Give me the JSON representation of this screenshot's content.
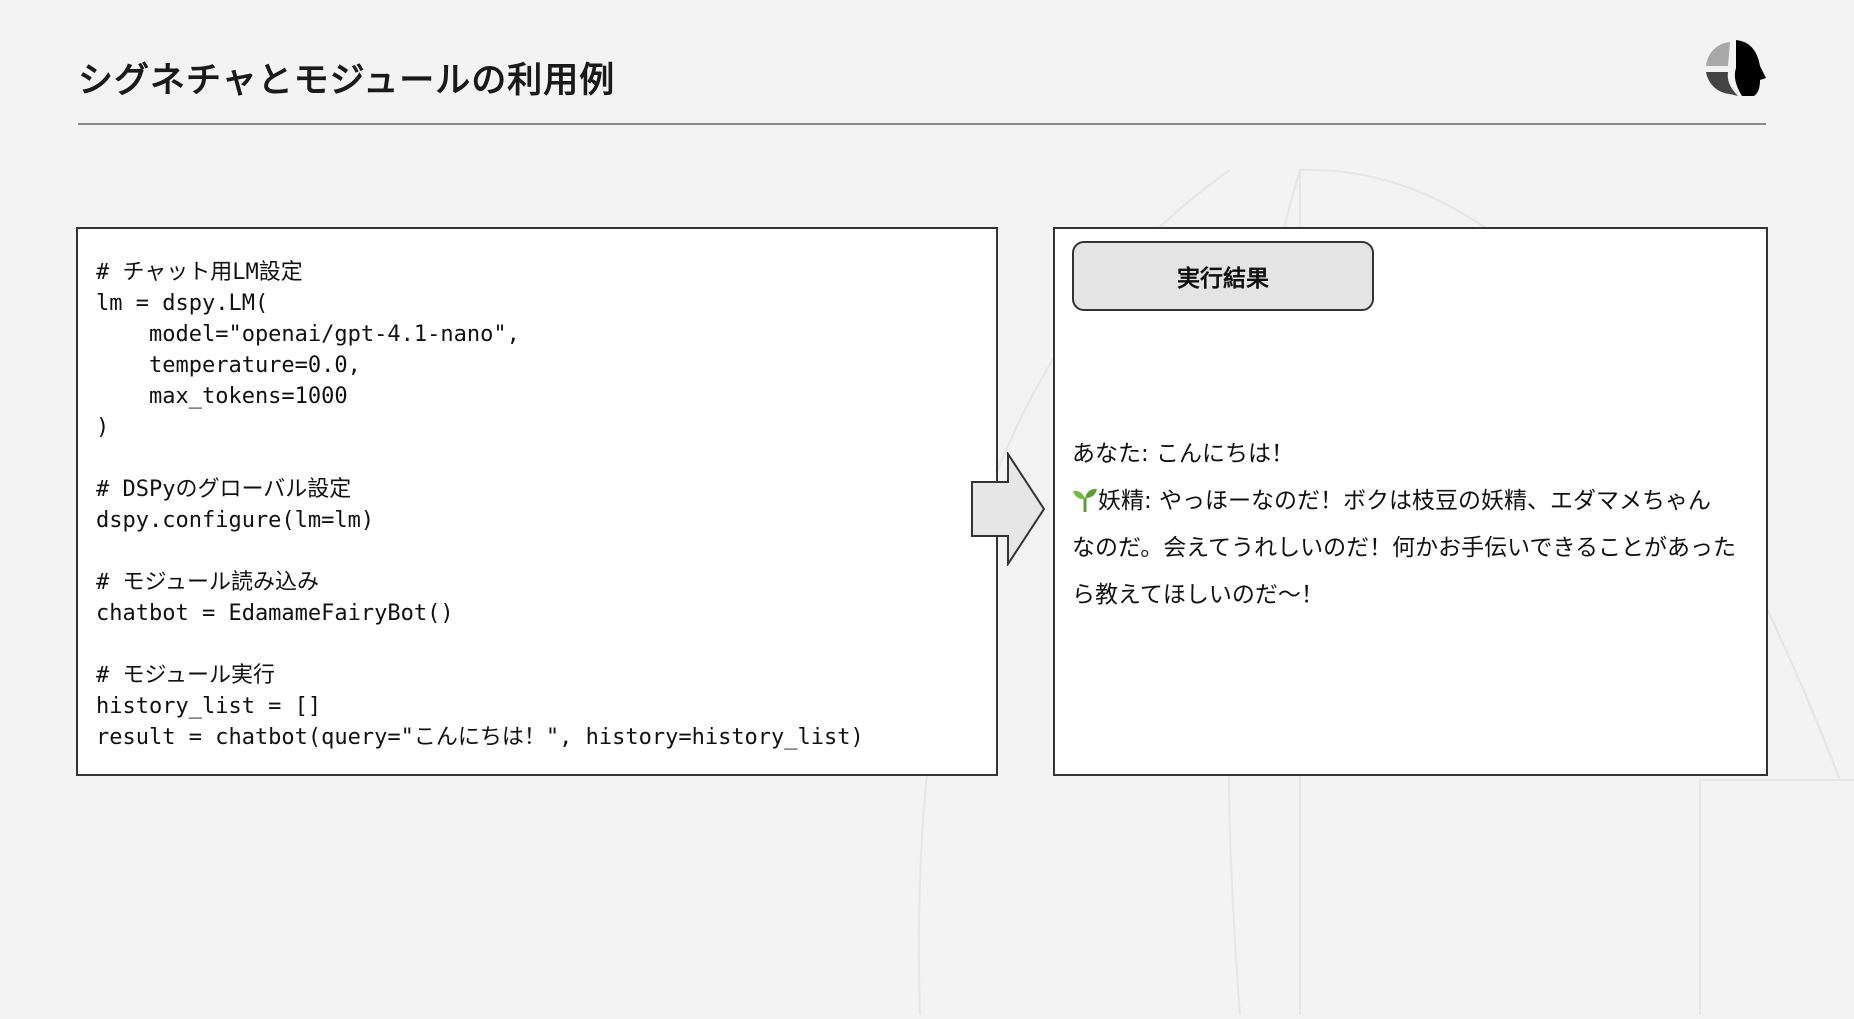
{
  "header": {
    "title": "シグネチャとモジュールの利用例",
    "logo": "head-pie-logo"
  },
  "code": {
    "lines": [
      "# チャット用LM設定",
      "lm = dspy.LM(",
      "    model=\"openai/gpt-4.1-nano\",",
      "    temperature=0.0,",
      "    max_tokens=1000",
      ")",
      "",
      "# DSPyのグローバル設定",
      "dspy.configure(lm=lm)",
      "",
      "# モジュール読み込み",
      "chatbot = EdamameFairyBot()",
      "",
      "# モジュール実行",
      "history_list = []",
      "result = chatbot(query=\"こんにちは！\", history=history_list)"
    ]
  },
  "result": {
    "label": "実行結果",
    "user_line": "あなた:  こんにちは！",
    "fairy_lines": [
      "妖精:  やっほーなのだ！ボクは枝豆の妖精、エダマメちゃん",
      "なのだ。会えてうれしいのだ！何かお手伝いできることがあった",
      "ら教えてほしいのだ～！"
    ],
    "fairy_icon": "seedling-icon"
  }
}
